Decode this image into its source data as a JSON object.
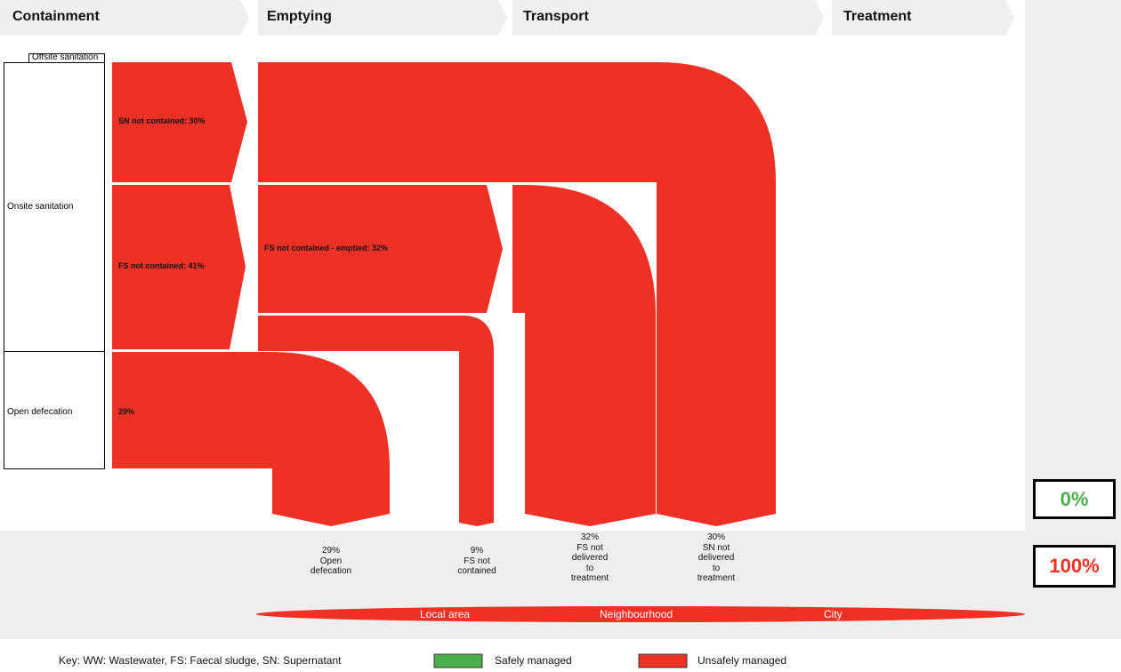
{
  "colors": {
    "safe": "#4cae4c",
    "unsafe": "#ee3124",
    "panel": "#eeeeee",
    "stage_header": "#efefef"
  },
  "stages": [
    "Containment",
    "Emptying",
    "Transport",
    "Treatment"
  ],
  "categories": {
    "offsite": "Offsite sanitation",
    "onsite": "Onsite sanitation",
    "open": "Open defecation"
  },
  "flows": {
    "sn_not_contained": "SN not contained: 30%",
    "fs_not_contained": "FS not contained: 41%",
    "open_defecation": "29%",
    "fs_emptied": "FS not contained - emptied: 32%"
  },
  "outcomes": [
    {
      "pct": "29%",
      "label": "Open defecation"
    },
    {
      "pct": "9%",
      "label": "FS not contained"
    },
    {
      "pct": "32%",
      "label": "FS not delivered to treatment"
    },
    {
      "pct": "30%",
      "label": "SN not delivered to treatment"
    }
  ],
  "scope": [
    "Local area",
    "Neighbourhood",
    "City"
  ],
  "scores": {
    "safe": "0%",
    "unsafe": "100%"
  },
  "key": {
    "abbrev": "Key: WW: Wastewater, FS: Faecal sludge, SN: Supernatant",
    "safe": "Safely managed",
    "unsafe": "Unsafely managed"
  }
}
